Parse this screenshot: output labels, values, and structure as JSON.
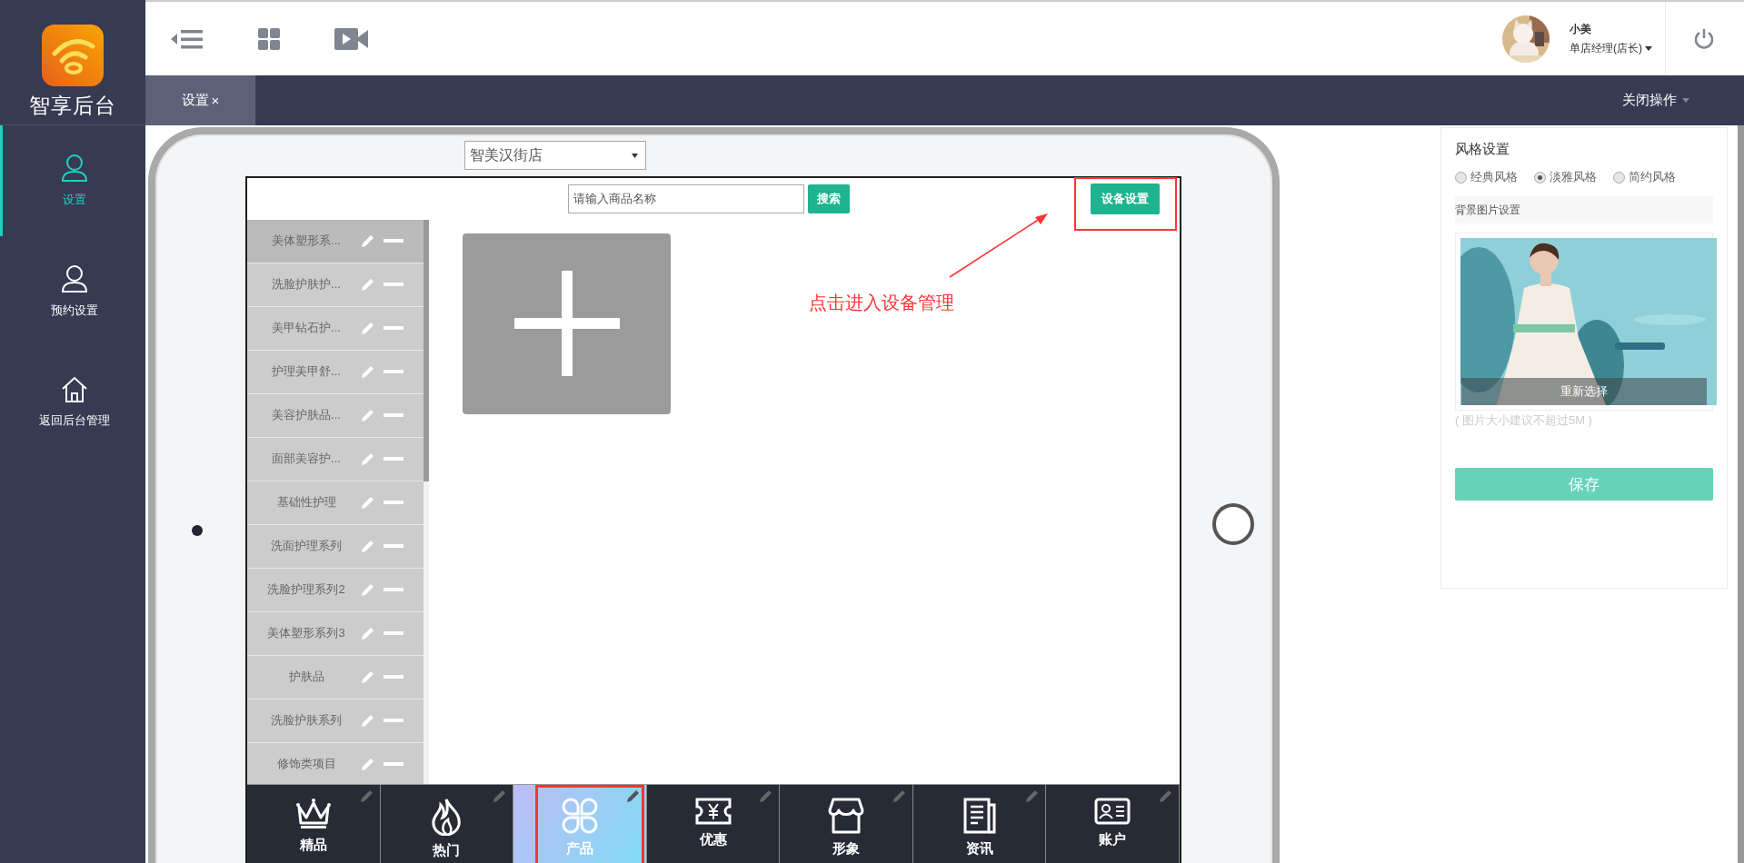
{
  "logo": {
    "text": "智享后台"
  },
  "nav": [
    {
      "label": "设置",
      "selected": true
    },
    {
      "label": "预约设置",
      "selected": false
    },
    {
      "label": "返回后台管理",
      "selected": false
    }
  ],
  "user": {
    "name": "小美",
    "role": "单店经理(店长)"
  },
  "tabs": [
    {
      "label": "设置",
      "close": "×",
      "selected": true
    }
  ],
  "close_menu": "关闭操作",
  "store_select": {
    "value": "智美汉街店"
  },
  "search": {
    "placeholder": "请输入商品名称",
    "button": "搜索"
  },
  "device_button": "设备设置",
  "annotation": "点击进入设备管理",
  "categories": [
    {
      "label": "美体塑形系...",
      "selected": true
    },
    {
      "label": "洗脸护肤护...",
      "selected": false
    },
    {
      "label": "美甲钻石护...",
      "selected": false
    },
    {
      "label": "护理美甲舒...",
      "selected": false
    },
    {
      "label": "美容护肤品...",
      "selected": false
    },
    {
      "label": "面部美容护...",
      "selected": false
    },
    {
      "label": "基础性护理",
      "selected": false
    },
    {
      "label": "洗面护理系列",
      "selected": false
    },
    {
      "label": "洗脸护理系列2",
      "selected": false
    },
    {
      "label": "美体塑形系列3",
      "selected": false
    },
    {
      "label": "护肤品",
      "selected": false
    },
    {
      "label": "洗脸护肤系列",
      "selected": false
    },
    {
      "label": "修饰类项目",
      "selected": false
    }
  ],
  "bottom_tabs": [
    {
      "label": "精品",
      "selected": false
    },
    {
      "label": "热门",
      "selected": false
    },
    {
      "label": "产品",
      "selected": true
    },
    {
      "label": "优惠",
      "selected": false
    },
    {
      "label": "形象",
      "selected": false
    },
    {
      "label": "资讯",
      "selected": false
    },
    {
      "label": "账户",
      "selected": false
    }
  ],
  "style_panel": {
    "title": "风格设置",
    "options": [
      {
        "label": "经典风格",
        "selected": false
      },
      {
        "label": "淡雅风格",
        "selected": true
      },
      {
        "label": "简约风格",
        "selected": false
      }
    ],
    "background_title": "背景图片设置",
    "reselect": "重新选择",
    "hint": "( 图片大小建议不超过5M )",
    "save": "保存"
  }
}
